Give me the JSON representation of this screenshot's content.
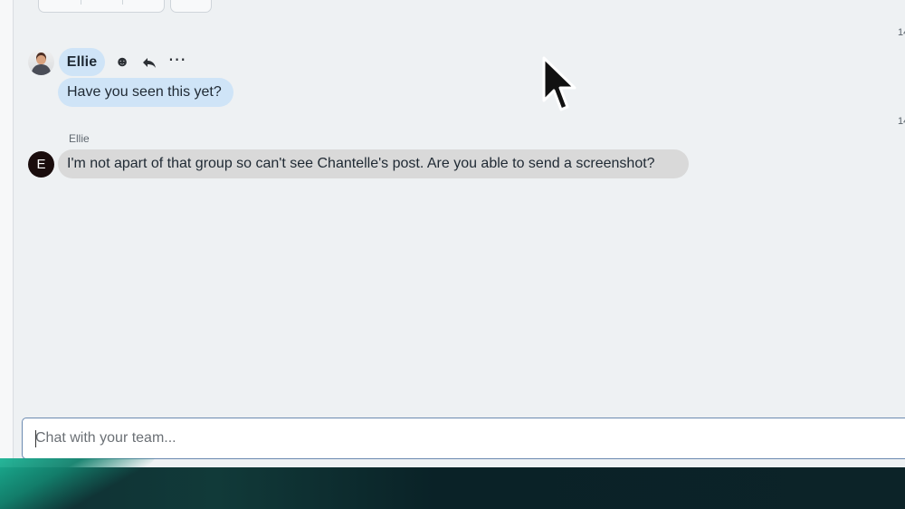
{
  "thread": {
    "time_marker_1": "14",
    "time_marker_2": "14"
  },
  "message_1": {
    "sender": "Ellie",
    "avatar": "person-photo-avatar",
    "actions": {
      "react_icon": "☻",
      "reply_icon": "⮌",
      "more_icon": "⋯"
    },
    "text": "Have you seen this yet?"
  },
  "message_2": {
    "sender": "Ellie",
    "avatar_initial": "E",
    "text": "I'm not apart of that group so can't see Chantelle's post. Are you able to send a screenshot?"
  },
  "composer": {
    "placeholder": "Chat with your team..."
  },
  "colors": {
    "bubble_blue": "#cfe4f7",
    "bubble_gray": "#d9d9d9",
    "background": "#eef1f3",
    "input_border": "#6b8ab0"
  }
}
